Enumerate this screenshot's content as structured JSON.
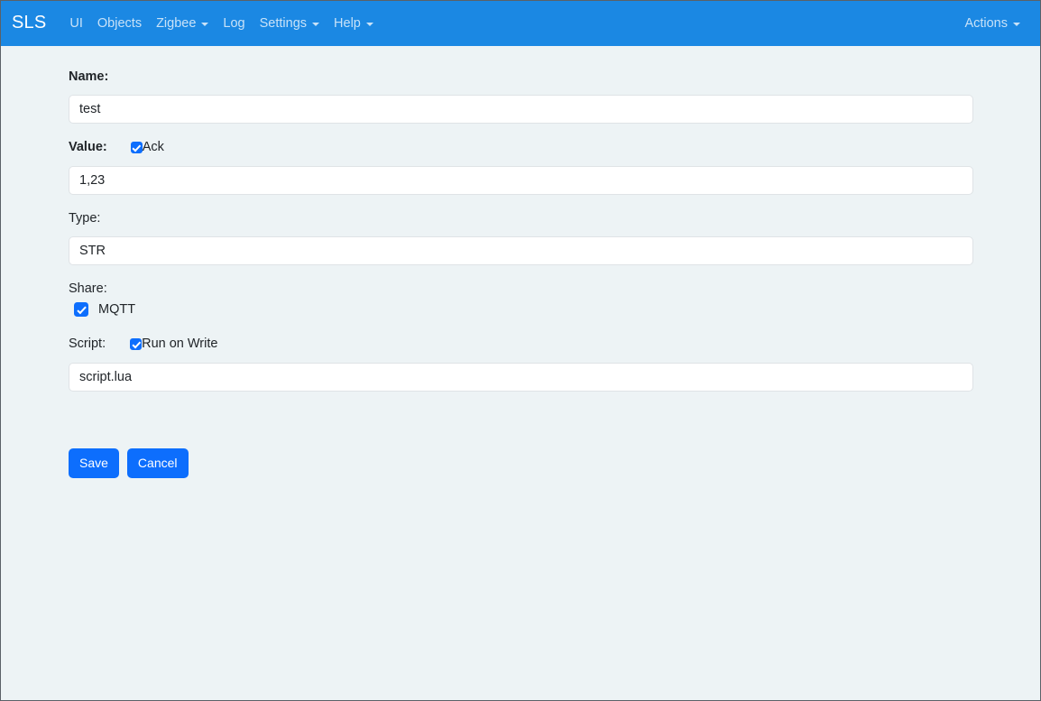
{
  "navbar": {
    "brand": "SLS",
    "items": [
      {
        "label": "UI",
        "caret": false
      },
      {
        "label": "Objects",
        "caret": false
      },
      {
        "label": "Zigbee",
        "caret": true
      },
      {
        "label": "Log",
        "caret": false
      },
      {
        "label": "Settings",
        "caret": true
      },
      {
        "label": "Help",
        "caret": true
      }
    ],
    "actions": {
      "label": "Actions",
      "caret": true
    }
  },
  "form": {
    "name": {
      "label": "Name:",
      "value": "test",
      "placeholder": ""
    },
    "value": {
      "label": "Value:",
      "ack_label": "Ack",
      "ack_checked": true,
      "value": "1,23",
      "placeholder": ""
    },
    "type": {
      "label": "Type:",
      "value": "STR",
      "placeholder": ""
    },
    "share": {
      "label": "Share:",
      "mqtt_label": "MQTT",
      "mqtt_checked": true
    },
    "script": {
      "label": "Script:",
      "run_on_write_label": "Run on Write",
      "run_on_write_checked": true,
      "value": "script.lua",
      "placeholder": ""
    },
    "buttons": {
      "save": "Save",
      "cancel": "Cancel"
    }
  },
  "colors": {
    "navbar_blue": "#1b88e3",
    "primary_blue": "#0d6efd",
    "page_background": "#edf3f5",
    "input_border": "#dfe3e6",
    "text": "#212529"
  }
}
